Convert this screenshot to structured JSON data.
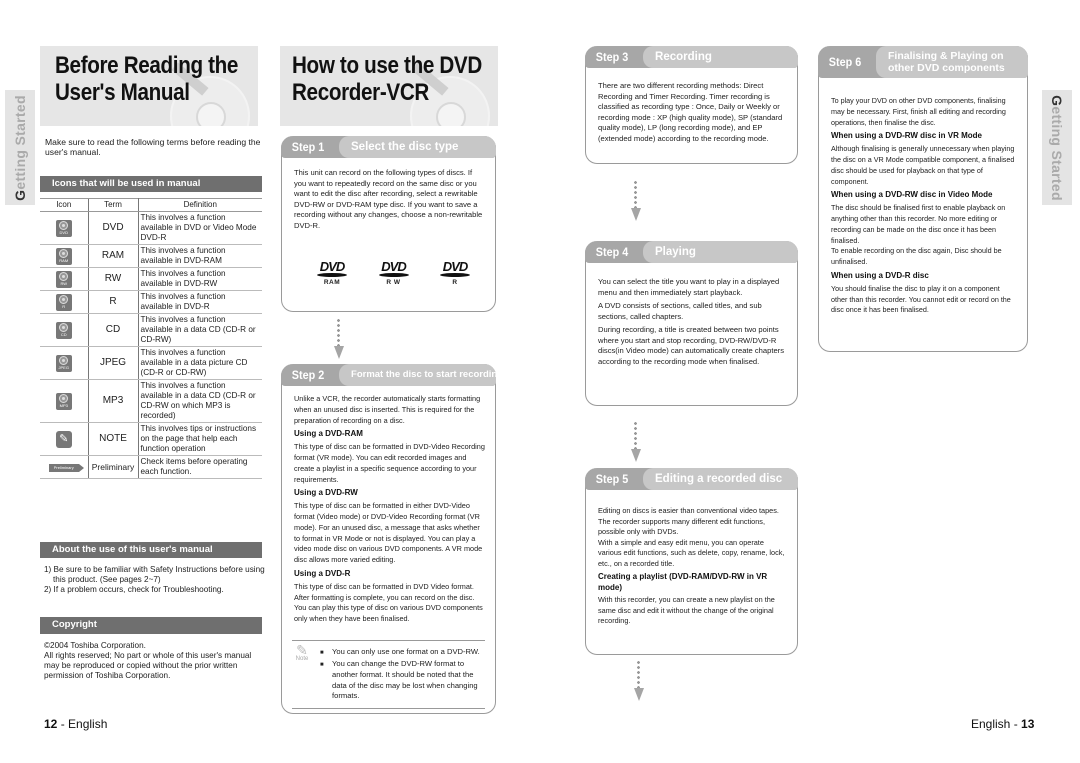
{
  "side_tab": {
    "first_letter": "G",
    "rest": "etting Started"
  },
  "left_page": {
    "title_line1": "Before Reading the",
    "title_line2": "User's Manual",
    "intro": "Make sure to read the following terms before reading the user's manual.",
    "icons_section": {
      "heading": "Icons that will be used in manual",
      "columns": [
        "Icon",
        "Term",
        "Definition"
      ],
      "rows": [
        {
          "icon": "dvd-disc-icon",
          "icon_label": "DVD",
          "term": "DVD",
          "definition": "This involves a function available in DVD or Video Mode DVD-R"
        },
        {
          "icon": "ram-disc-icon",
          "icon_label": "RAM",
          "term": "RAM",
          "definition": "This involves a function available in DVD-RAM"
        },
        {
          "icon": "rw-disc-icon",
          "icon_label": "RW",
          "term": "RW",
          "definition": "This involves a function available in DVD-RW"
        },
        {
          "icon": "r-disc-icon",
          "icon_label": "R",
          "term": "R",
          "definition": "This involves a function available in DVD-R"
        },
        {
          "icon": "cd-disc-icon",
          "icon_label": "CD",
          "term": "CD",
          "definition": "This involves a function available in a data CD (CD-R or CD-RW)"
        },
        {
          "icon": "jpeg-disc-icon",
          "icon_label": "JPEG",
          "term": "JPEG",
          "definition": "This involves a function available in a data picture CD (CD-R or CD-RW)"
        },
        {
          "icon": "mp3-disc-icon",
          "icon_label": "MP3",
          "term": "MP3",
          "definition": "This involves a function available in a data CD (CD-R or CD-RW on which MP3 is recorded)"
        },
        {
          "icon": "note-pencil-icon",
          "icon_label": "",
          "term": "NOTE",
          "definition": "This involves tips or instructions on the page that help each function operation"
        },
        {
          "icon": "preliminary-arrow-icon",
          "icon_label": "Preliminary",
          "term": "Preliminary",
          "definition": "Check items before operating each function."
        }
      ]
    },
    "about_section": {
      "heading": "About the use of this user's manual",
      "items": [
        "1) Be sure to be familiar with Safety Instructions before using this product. (See pages 2~7)",
        "2) If a problem occurs, check for Troubleshooting."
      ]
    },
    "copyright_section": {
      "heading": "Copyright",
      "line1": "©2004 Toshiba Corporation.",
      "body": "All rights reserved; No part or whole of this user's manual may be reproduced or copied without the prior written permission of Toshiba Corporation."
    },
    "page_number": "12",
    "page_language": "- English"
  },
  "middle_page": {
    "title_line1": "How to use the DVD",
    "title_line2": "Recorder-VCR",
    "step1": {
      "num": "Step 1",
      "title": "Select the disc type",
      "body": "This unit can record on the following types of discs. If you want to repeatedly record on the same disc or you want to edit the disc after recording, select a rewritable DVD-RW or DVD-RAM type disc. If you want to save a recording without any changes, choose a non-rewritable DVD-R.",
      "logos": [
        {
          "wordmark": "DVD",
          "label": "RAM"
        },
        {
          "wordmark": "DVD",
          "label": "R W"
        },
        {
          "wordmark": "DVD",
          "label": "R"
        }
      ]
    },
    "step2": {
      "num": "Step 2",
      "title": "Format the disc to start recording",
      "intro": "Unlike a VCR, the recorder automatically starts formatting when an unused disc is inserted. This is required for the preparation of recording on a disc.",
      "sub1_heading": "Using a DVD-RAM",
      "sub1_body": "This type of disc can be formatted in DVD-Video Recording format (VR mode). You can edit recorded images and create a playlist in a specific sequence according to your requirements.",
      "sub2_heading": "Using a DVD-RW",
      "sub2_body": "This type of disc can be formatted in either DVD-Video format (Video mode) or DVD-Video Recording format (VR mode). For an unused disc, a message that asks whether to format in VR Mode or not is displayed. You can play a video mode disc on various DVD components. A VR mode disc allows more varied editing.",
      "sub3_heading": "Using a DVD-R",
      "sub3_body": "This type of disc can be formatted in DVD Video format. After formatting is complete, you can record on the disc. You can play this type of disc on various DVD components only when they have been finalised.",
      "note_label": "Note",
      "notes": [
        "You can only use one format on a DVD-RW.",
        "You can change the DVD-RW format to another format. It should be noted that the data of the disc may be lost when changing formats."
      ]
    }
  },
  "right_page": {
    "step3": {
      "num": "Step 3",
      "title": "Recording",
      "body": "There are two different recording methods: Direct Recording and Timer Recording. Timer recording is classified as recording type : Once, Daily or Weekly or recording mode : XP (high quality mode), SP (standard quality mode), LP (long recording mode), and EP (extended mode) according to the recording mode."
    },
    "step4": {
      "num": "Step 4",
      "title": "Playing",
      "paragraphs": [
        "You can select the title you want to play in a displayed menu and then immediately start playback.",
        "A DVD consists of sections, called titles, and sub sections, called chapters.",
        "During recording, a title is created between two points where you start and stop recording, DVD-RW/DVD-R discs(in Video mode) can automatically create chapters according to the recording mode when finalised."
      ]
    },
    "step5": {
      "num": "Step 5",
      "title": "Editing a recorded disc",
      "p1": "Editing on discs is easier than conventional video tapes. The recorder supports many different edit functions, possible only with DVDs.",
      "p2": "With a simple and easy edit menu, you can operate various edit functions, such as delete, copy, rename, lock, etc., on a recorded title.",
      "sub_heading": "Creating a playlist (DVD-RAM/DVD-RW in VR mode)",
      "sub_body": "With this recorder, you can create a new playlist on the same disc and edit it without the change of the original recording."
    },
    "step6": {
      "num": "Step 6",
      "title_line1": "Finalising & Playing on",
      "title_line2": "other DVD components",
      "intro": "To play your DVD on other DVD components, finalising may be necessary. First, finish all editing and recording operations, then finalise the disc.",
      "sub1_heading": "When using a DVD-RW disc in VR Mode",
      "sub1_body": "Although finalising is generally unnecessary when playing the disc on a VR Mode compatible component, a finalised disc should be used for playback on that type of component.",
      "sub2_heading": "When using a DVD-RW disc in Video Mode",
      "sub2_body1": "The disc should be finalised first to enable playback on anything other than this recorder. No more editing or recording can be made on the disc once it has been finalised.",
      "sub2_body2": "To enable recording on the disc again, Disc should be unfinalised.",
      "sub3_heading": "When using a DVD-R disc",
      "sub3_body": "You should finalise the disc to play it on a component other than this recorder. You cannot edit or record on the disc once it has been finalised."
    },
    "page_language": "English -",
    "page_number": "13"
  }
}
